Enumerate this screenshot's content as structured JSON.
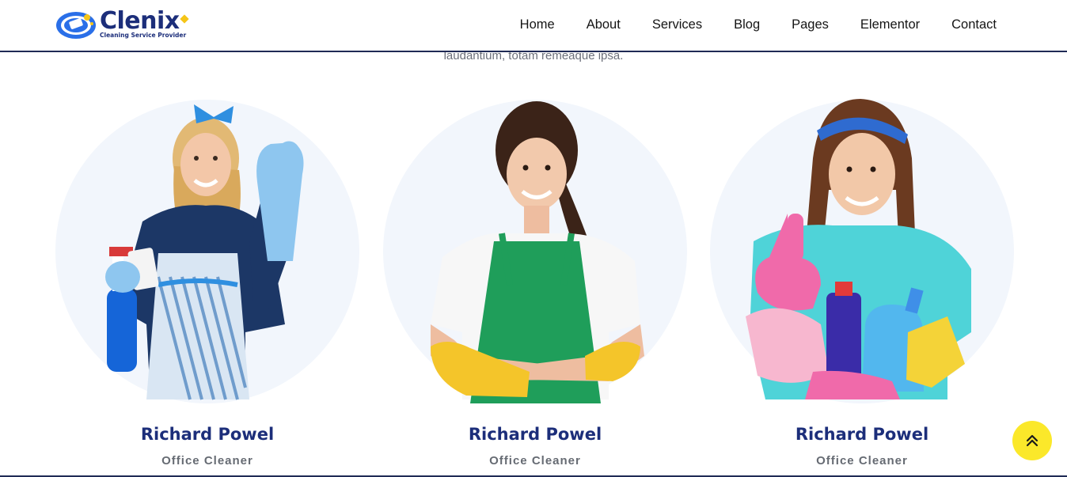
{
  "brand": {
    "name": "Clenix",
    "tagline": "Cleaning Service Provider",
    "colors": {
      "primary": "#1c2e7a",
      "accent": "#f5c518",
      "logo_blue": "#2a6fe8"
    }
  },
  "nav": {
    "items": [
      {
        "label": "Home"
      },
      {
        "label": "About"
      },
      {
        "label": "Services"
      },
      {
        "label": "Blog"
      },
      {
        "label": "Pages"
      },
      {
        "label": "Elementor"
      },
      {
        "label": "Contact"
      }
    ]
  },
  "intro": {
    "text": "laudantium, totam remeaque ipsa."
  },
  "team": {
    "members": [
      {
        "name": "Richard Powel",
        "role": "Office Cleaner",
        "photo": "cleaner-blue-apron-ok-gesture"
      },
      {
        "name": "Richard Powel",
        "role": "Office Cleaner",
        "photo": "cleaner-green-apron-arms-crossed"
      },
      {
        "name": "Richard Powel",
        "role": "Office Cleaner",
        "photo": "cleaner-thumbs-up-with-bottles"
      }
    ]
  },
  "scroll_top": {
    "icon": "double-chevron-up-icon",
    "color": "#fbe82a"
  }
}
